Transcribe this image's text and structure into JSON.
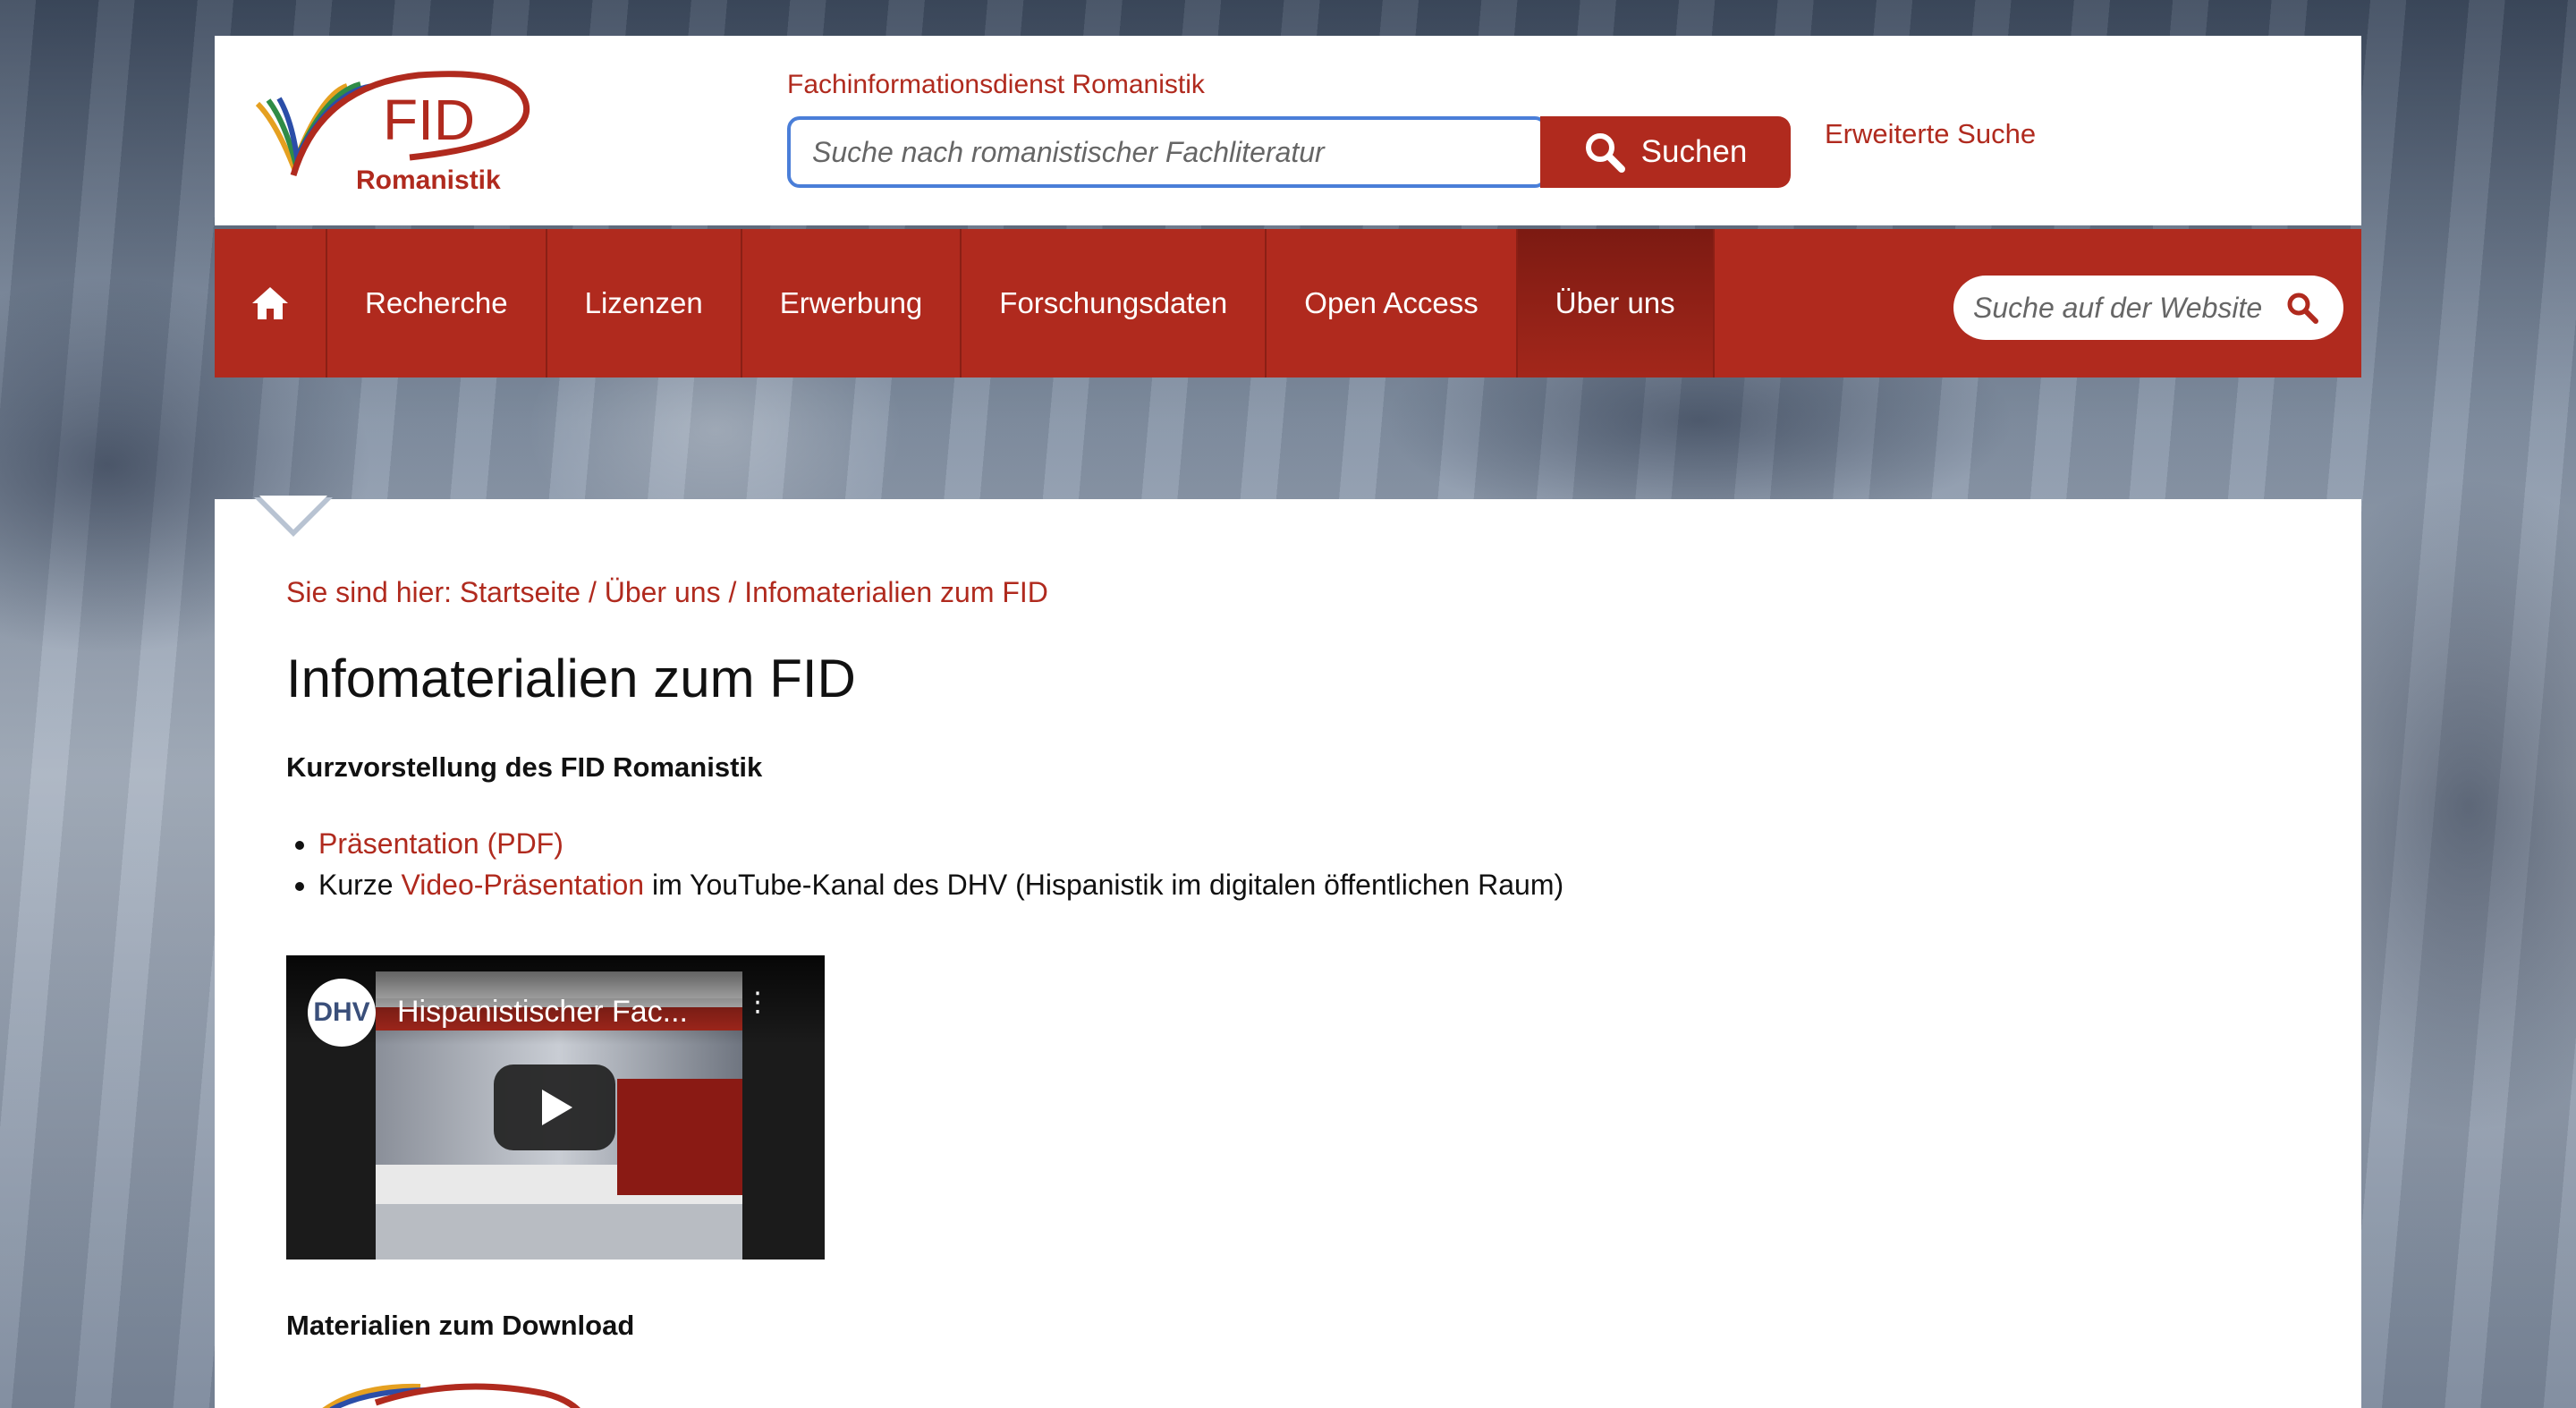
{
  "header": {
    "logo_text_top": "FID",
    "logo_text_bottom": "Romanistik",
    "service_name": "Fachinformationsdienst Romanistik",
    "search_placeholder": "Suche nach romanistischer Fachliteratur",
    "search_button_label": "Suchen",
    "advanced_search_label": "Erweiterte Suche"
  },
  "nav": {
    "home_icon": "home-icon",
    "items": [
      {
        "label": "Recherche"
      },
      {
        "label": "Lizenzen"
      },
      {
        "label": "Erwerbung"
      },
      {
        "label": "Forschungsdaten"
      },
      {
        "label": "Open Access"
      },
      {
        "label": "Über uns",
        "active": true
      }
    ],
    "site_search_placeholder": "Suche auf der Website"
  },
  "breadcrumb": {
    "prefix": "Sie sind hier:",
    "items": [
      "Startseite",
      "Über uns",
      "Infomaterialien zum FID"
    ],
    "separator": "/"
  },
  "page": {
    "title": "Infomaterialien zum FID",
    "section1_heading": "Kurzvorstellung des FID Romanistik",
    "bullet1_link": "Präsentation (PDF)",
    "bullet2_prefix": "Kurze",
    "bullet2_link": "Video-Präsentation",
    "bullet2_suffix": "im YouTube-Kanal des DHV (Hispanistik im digitalen öffentlichen Raum)",
    "section2_heading": "Materialien zum Download"
  },
  "video": {
    "channel_badge": "DHV",
    "title": "Hispanistischer Fac..."
  },
  "colors": {
    "brand_red": "#b02a1e",
    "focus_blue": "#4a7ed8"
  }
}
